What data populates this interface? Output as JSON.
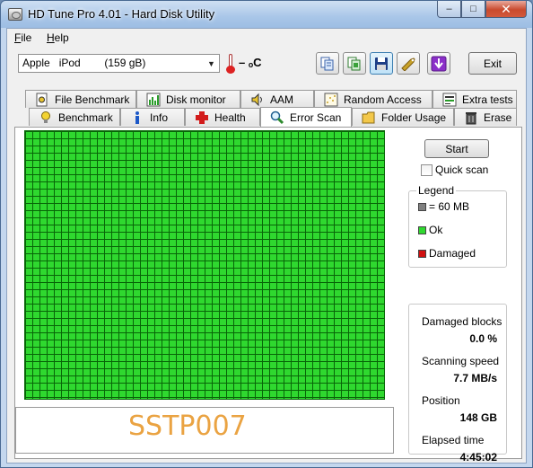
{
  "window": {
    "title": "HD Tune Pro 4.01 - Hard Disk Utility"
  },
  "caption_buttons": {
    "minimize": "–",
    "maximize": "□",
    "close": "✕"
  },
  "menu": [
    {
      "label": "File",
      "accel": "F",
      "rest": "ile"
    },
    {
      "label": "Help",
      "accel": "H",
      "rest": "elp"
    }
  ],
  "toolbar": {
    "drive": {
      "selected": "Apple   iPod        (159 gB)"
    },
    "temperature": "– ₒC",
    "exit_label": "Exit"
  },
  "tabs": {
    "row1": [
      "File Benchmark",
      "Disk monitor",
      "AAM",
      "Random Access",
      "Extra tests"
    ],
    "row2": [
      "Benchmark",
      "Info",
      "Health",
      "Error Scan",
      "Folder Usage",
      "Erase"
    ],
    "selected": "Error Scan"
  },
  "scan": {
    "start_label": "Start",
    "quick_scan_label": "Quick scan",
    "legend": {
      "title": "Legend",
      "items": [
        {
          "label": "= 60 MB",
          "color": "#808080"
        },
        {
          "label": "Ok",
          "color": "#2fd82f"
        },
        {
          "label": "Damaged",
          "color": "#d01010"
        }
      ]
    },
    "stats": {
      "damaged_blocks_label": "Damaged blocks",
      "damaged_blocks_value": "0.0 %",
      "speed_label": "Scanning speed",
      "speed_value": "7.7 MB/s",
      "position_label": "Position",
      "position_value": "148 GB",
      "elapsed_label": "Elapsed time",
      "elapsed_value": "4:45:02"
    }
  },
  "watermark": "SSTP007"
}
